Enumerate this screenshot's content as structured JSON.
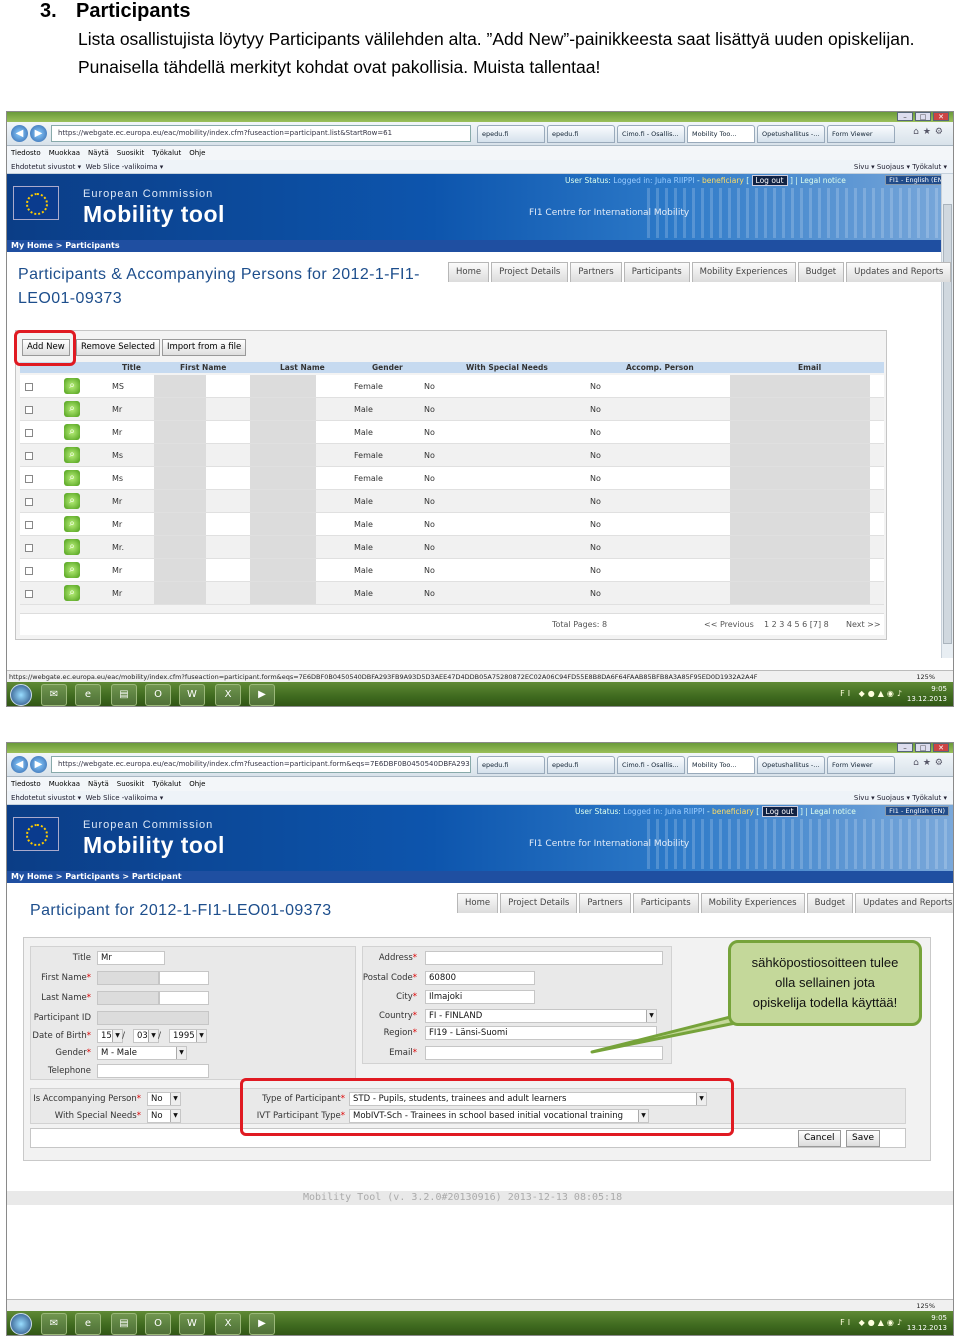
{
  "doc": {
    "heading_num": "3.",
    "heading": "Participants",
    "para1": "Lista osallistujista löytyy Participants välilehden alta. ”Add New”-painikkeesta saat lisättyä uuden opiskelijan.",
    "para2": "Punaisella tähdellä merkityt kohdat ovat pakollisia. Muista tallentaa!"
  },
  "browser": {
    "url1": "https://webgate.ec.europa.eu/eac/mobility/index.cfm?fuseaction=participant.list&StartRow=61",
    "url2": "https://webgate.ec.europa.eu/eac/mobility/index.cfm?fuseaction=participant.form&eqs=7E6DBF0B0450540DBFA293F89:",
    "tabs": [
      "epedu.fi",
      "epedu.fi",
      "Cimo.fi - Osallis...",
      "Mobility Too...",
      "Opetushallitus -...",
      "Form Viewer"
    ],
    "menu": [
      "Tiedosto",
      "Muokkaa",
      "Näytä",
      "Suosikit",
      "Työkalut",
      "Ohje"
    ],
    "fav1": "Ehdotetut sivustot ▾",
    "fav2": "Web Slice -valikoima ▾",
    "fav_right": "Sivu ▾   Suojaus ▾   Työkalut ▾",
    "status_url": "https://webgate.ec.europa.eu/eac/mobility/index.cfm?fuseaction=participant.form&eqs=7E6DBF0B0450540DBFA293FB9A93D5D3AEE47D4DDB05A75280872EC02A06C94FD55E8B8DA6F64FAAB85BFB8A3A85F95ED0D1932A2A4F",
    "zoom": "125%",
    "clock_time": "9:05",
    "clock_date": "13.12.2013",
    "tray_lang": "FI"
  },
  "app": {
    "ec": "European Commission",
    "title": "Mobility tool",
    "centre": "FI1 Centre for International Mobility",
    "status_label": "User Status:",
    "status_value": "Logged in:",
    "user": "Juha RIIPPI",
    "role": "beneficiary",
    "logout": "Log out",
    "legal": "Legal notice",
    "lang": "FI1 - English (EN)",
    "tabs": [
      "Home",
      "Project Details",
      "Partners",
      "Participants",
      "Mobility Experiences",
      "Budget",
      "Updates and Reports"
    ]
  },
  "list_page": {
    "crumb": "My Home  >  Participants",
    "title_line1": "Participants & Accompanying Persons for 2012-1-FI1-",
    "title_line2": "LEO01-09373",
    "add_new": "Add New",
    "remove": "Remove Selected",
    "import": "Import from a file",
    "columns": [
      "Title",
      "First Name",
      "Last Name",
      "Gender",
      "With Special Needs",
      "Accomp. Person",
      "Email"
    ],
    "rows": [
      {
        "title": "MS",
        "gender": "Female",
        "special": "No",
        "accomp": "No"
      },
      {
        "title": "Mr",
        "gender": "Male",
        "special": "No",
        "accomp": "No"
      },
      {
        "title": "Mr",
        "gender": "Male",
        "special": "No",
        "accomp": "No"
      },
      {
        "title": "Ms",
        "gender": "Female",
        "special": "No",
        "accomp": "No"
      },
      {
        "title": "Ms",
        "gender": "Female",
        "special": "No",
        "accomp": "No"
      },
      {
        "title": "Mr",
        "gender": "Male",
        "special": "No",
        "accomp": "No"
      },
      {
        "title": "Mr",
        "gender": "Male",
        "special": "No",
        "accomp": "No"
      },
      {
        "title": "Mr.",
        "gender": "Male",
        "special": "No",
        "accomp": "No"
      },
      {
        "title": "Mr",
        "gender": "Male",
        "special": "No",
        "accomp": "No"
      },
      {
        "title": "Mr",
        "gender": "Male",
        "special": "No",
        "accomp": "No"
      }
    ],
    "total_pages": "Total Pages: 8",
    "previous": "<< Previous",
    "pages": "1  2  3  4  5  6  [7]  8",
    "next": "Next >>"
  },
  "form_page": {
    "crumb": "My Home  >  Participants  >  Participant",
    "title": "Participant for 2012-1-FI1-LEO01-09373",
    "labels": {
      "title": "Title",
      "first_name": "First Name",
      "last_name": "Last Name",
      "participant_id": "Participant ID",
      "dob": "Date of Birth",
      "gender": "Gender",
      "telephone": "Telephone",
      "address": "Address",
      "postal_code": "Postal Code",
      "city": "City",
      "country": "Country",
      "region": "Region",
      "email": "Email",
      "accompanying": "Is Accompanying Person",
      "special_needs": "With Special Needs",
      "type": "Type of Participant",
      "ivt_type": "IVT Participant Type"
    },
    "values": {
      "title": "Mr",
      "dob_day": "15",
      "dob_month": "03",
      "dob_year": "1995",
      "gender": "M - Male",
      "postal_code": "60800",
      "city": "Ilmajoki",
      "country": "FI - FINLAND",
      "region": "FI19 - Länsi-Suomi",
      "accompanying": "No",
      "special_needs": "No",
      "type": "STD - Pupils, students, trainees and adult learners",
      "ivt_type": "MobIVT-Sch - Trainees in school based initial vocational training"
    },
    "cancel": "Cancel",
    "save": "Save",
    "footer": "Mobility Tool (v. 3.2.0#20130916) 2013-12-13 08:05:18"
  },
  "callout": {
    "line1": "sähköpostiosoitteen tulee",
    "line2": "olla sellainen jota",
    "line3": "opiskelija todella käyttää!"
  }
}
